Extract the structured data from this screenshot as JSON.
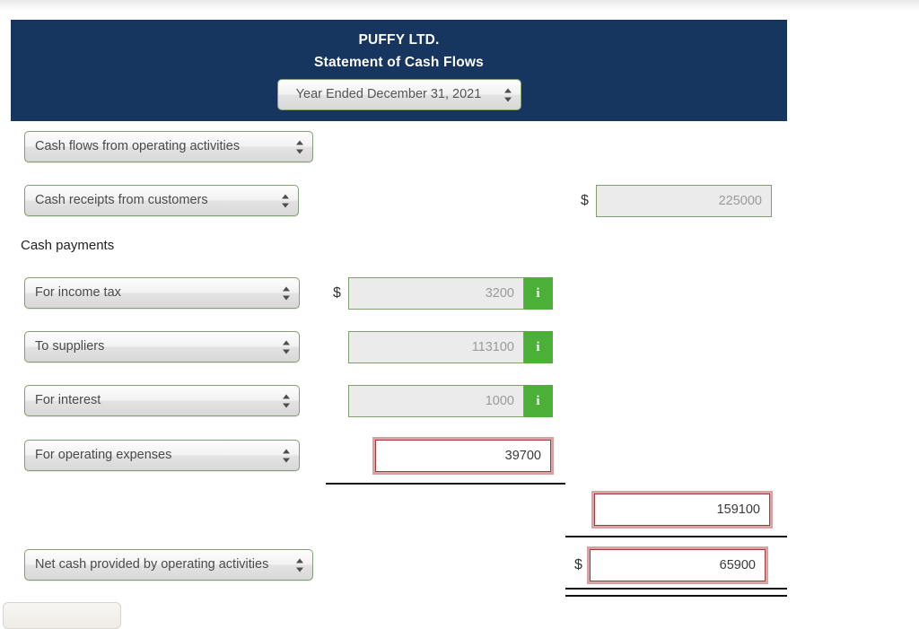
{
  "header": {
    "company": "PUFFY LTD.",
    "statement": "Statement of Cash Flows",
    "period": "Year Ended December 31, 2021"
  },
  "colors": {
    "header_navy": "#16365f",
    "info_green": "#4caf38",
    "select_border_green": "#7fa070",
    "error_red": "#a33c3c",
    "error_ring": "#d9a2a2"
  },
  "section_label": "Cash payments",
  "currency_symbol": "$",
  "rows": [
    {
      "label": "Cash flows from operating activities",
      "amount": "",
      "info": ""
    },
    {
      "label": "Cash receipts from customers",
      "amount": "225000",
      "info": ""
    },
    {
      "label": "For income tax",
      "amount": "3200",
      "info": "i"
    },
    {
      "label": "To suppliers",
      "amount": "113100",
      "info": "i"
    },
    {
      "label": "For interest",
      "amount": "1000",
      "info": "i"
    },
    {
      "label": "For operating expenses",
      "amount": "39700",
      "info": ""
    },
    {
      "label": "Net cash provided by operating activities",
      "amount": "65900",
      "info": ""
    }
  ],
  "subtotal": {
    "amount": "159100"
  }
}
